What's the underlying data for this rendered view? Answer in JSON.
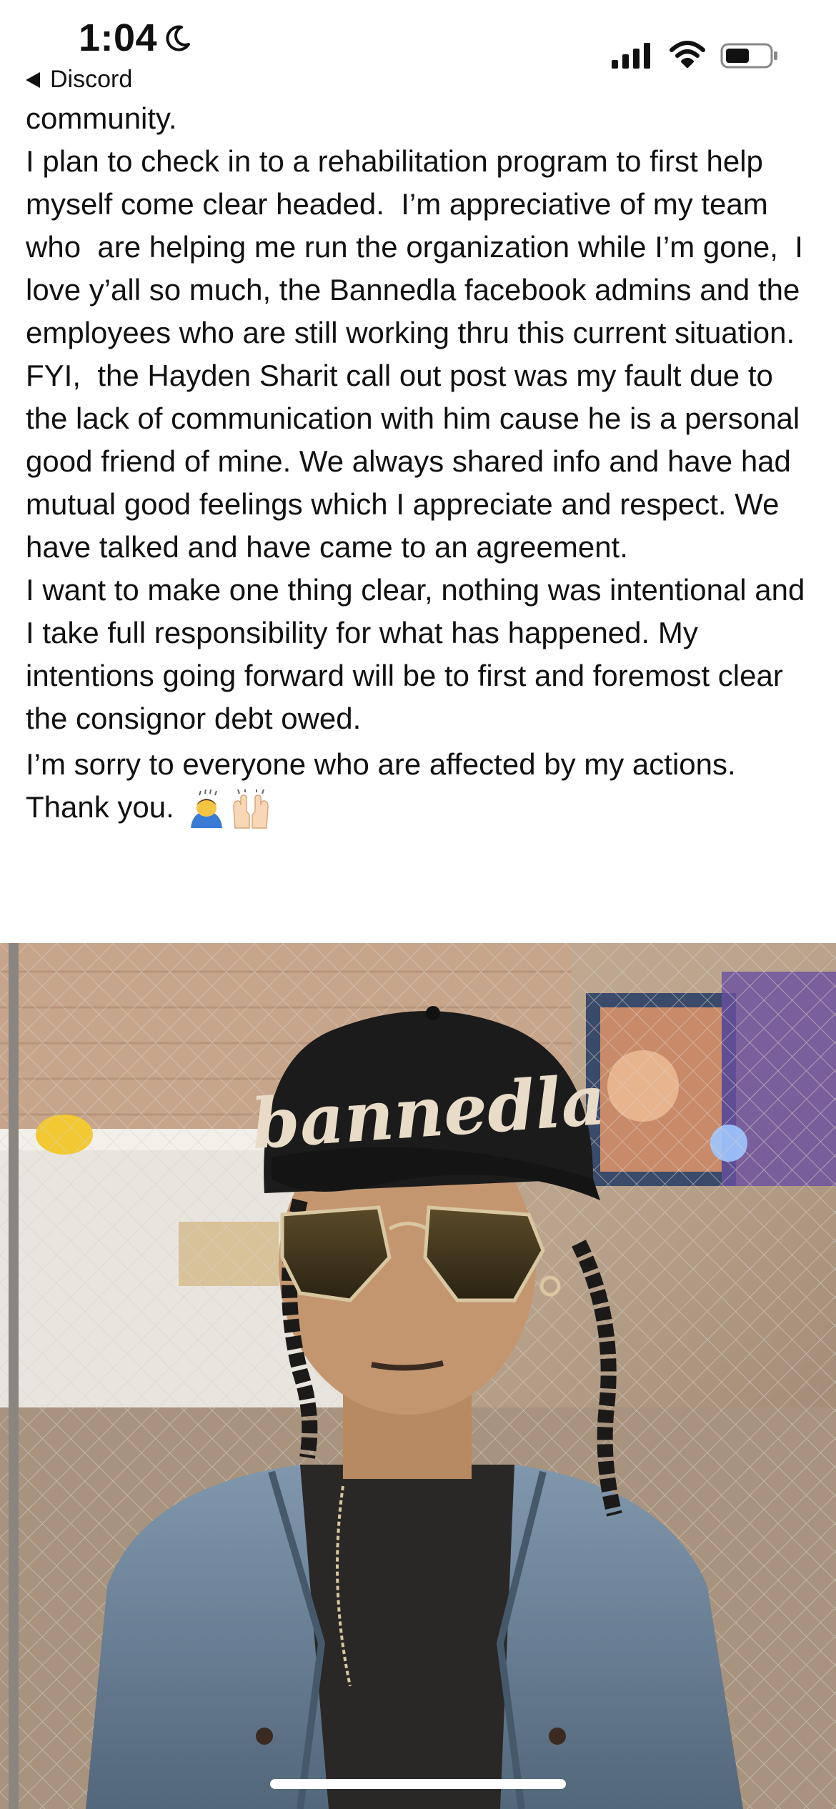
{
  "status_bar": {
    "time": "1:04",
    "back_label": "Discord",
    "icons": [
      "moon-icon",
      "cellular-signal-icon",
      "wifi-icon",
      "battery-icon"
    ]
  },
  "post": {
    "paragraphs": [
      "community.",
      "I plan to check in to a rehabilitation program to first help myself come clear headed.  I’m appreciative of my team who  are helping me run the organization while I’m gone,  I love y’all so much, the Bannedla facebook admins and the employees who are still working thru this current situation.",
      "FYI,  the Hayden Sharit call out post was my fault due to the lack of communication with him cause he is a personal good friend of mine. We always shared info and have had mutual good feelings which I appreciate and respect. We have talked and have came to an agreement.",
      "I want to make one thing clear, nothing was intentional and I take full responsibility for what has happened. My intentions going forward will be to first and foremost clear the consignor debt owed."
    ],
    "closing_text": "I’m sorry to everyone who are affected by my actions. Thank you.",
    "closing_emojis": [
      "person-bowing-emoji",
      "raising-hands-emoji"
    ]
  },
  "photo": {
    "cap_text": "bannedla"
  },
  "colors": {
    "text": "#111111",
    "background": "#ffffff"
  }
}
